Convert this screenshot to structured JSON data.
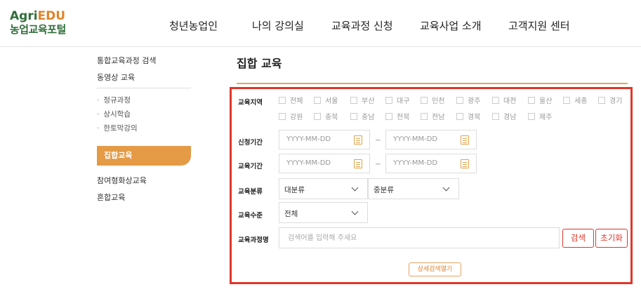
{
  "logo": {
    "line1_a": "Agri",
    "line1_b": "EDU",
    "line2": "농업교육포털"
  },
  "gnb": [
    "청년농업인",
    "나의 강의실",
    "교육과정 신청",
    "교육사업 소개",
    "고객지원 센터"
  ],
  "sidebar": {
    "top_items": [
      "통합교육과정 검색",
      "동영상 교육"
    ],
    "sub_items": [
      "정규과정",
      "상시학습",
      "한토막강의"
    ],
    "active": "집합교육",
    "bottom_items": [
      "참여형화상교육",
      "혼합교육"
    ]
  },
  "page_title": "집합 교육",
  "search": {
    "region_label": "교육지역",
    "regions_row1": [
      "전체",
      "서울",
      "부산",
      "대구",
      "인천",
      "광주",
      "대전",
      "울산",
      "세종",
      "경기"
    ],
    "regions_row2": [
      "강원",
      "충북",
      "충남",
      "전북",
      "전남",
      "경북",
      "경남",
      "제주"
    ],
    "apply_period_label": "신청기간",
    "edu_period_label": "교육기간",
    "date_placeholder": "YYYY-MM-DD",
    "tilde": "~",
    "category_label": "교육분류",
    "category_major": "대분류",
    "category_minor": "중분류",
    "level_label": "교육수준",
    "level_value": "전체",
    "course_name_label": "교육과정명",
    "course_name_placeholder": "검색어를 입력해 주세요",
    "search_button": "검색",
    "reset_button": "초기화",
    "detail_button": "상세검색열기"
  },
  "colors": {
    "brand_green": "#2f6d3a",
    "accent_orange": "#e59a45",
    "highlight_red": "#e0362c"
  }
}
